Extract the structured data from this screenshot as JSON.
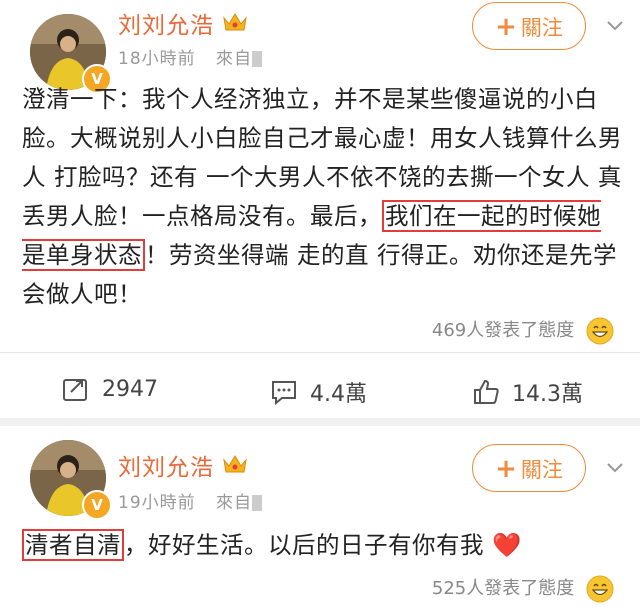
{
  "posts": [
    {
      "user_name": "刘刘允浩",
      "time": "18小時前",
      "source_prefix": "來自",
      "follow_label": "關注",
      "content_before": "澄清一下：我个人经济独立，并不是某些傻逼说的小白脸。大概说别人小白脸自己才最心虚！用女人钱算什么男人 打脸吗？还有 一个大男人不依不饶的去撕一个女人 真丢男人脸！一点格局没有。最后，",
      "content_highlight": "我们在一起的时候她是单身状态",
      "content_after": "！劳资坐得端 走的直 行得正。劝你还是先学会做人吧！",
      "reactions": "469人發表了態度",
      "actions": {
        "repost": "2947",
        "comment": "4.4萬",
        "like": "14.3萬"
      }
    },
    {
      "user_name": "刘刘允浩",
      "time": "19小時前",
      "source_prefix": "來自",
      "follow_label": "關注",
      "content_highlight": "清者自清",
      "content_after": "，好好生活。以后的日子有你有我",
      "emoji": "❤️",
      "reactions": "525人發表了態度"
    }
  ],
  "colors": {
    "name": "#e8693a",
    "follow": "#f08a3c",
    "highlight": "#e23c3c"
  }
}
